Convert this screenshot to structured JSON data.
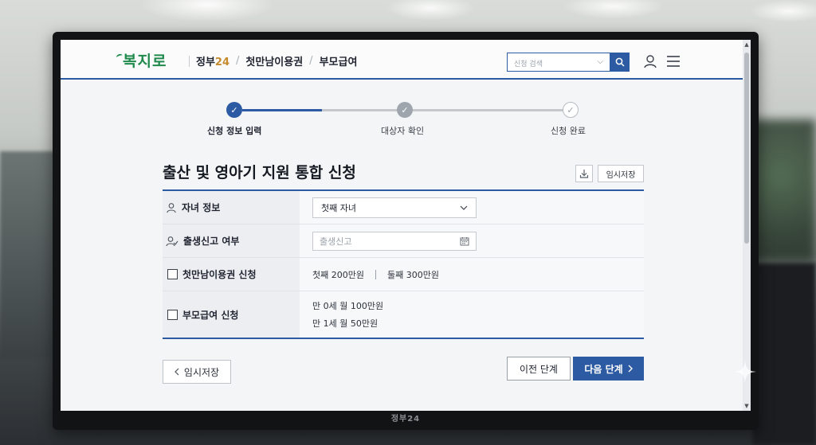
{
  "header": {
    "logo": "복지로",
    "nav": [
      {
        "label_main": "정부",
        "label_accent": "24"
      },
      {
        "label": "첫만남이용권"
      },
      {
        "label": "부모급여"
      }
    ],
    "search_placeholder": "신청 검색",
    "accent_color": "#2d5ba3"
  },
  "stepper": {
    "steps": [
      {
        "label": "신청 정보 입력",
        "state": "active"
      },
      {
        "label": "대상자 확인",
        "state": "done"
      },
      {
        "label": "신청 완료",
        "state": "pending"
      }
    ]
  },
  "page": {
    "title": "출산 및 영아기 지원 통합 신청",
    "temp_save_label": "임시저장"
  },
  "form": {
    "rows": [
      {
        "label": "자녀 정보",
        "icon": "user-icon",
        "value": "첫째 자녀"
      },
      {
        "label": "출생신고 여부",
        "icon": "user-check-icon",
        "placeholder": "출생신고"
      },
      {
        "label": "첫만남이용권 신청",
        "checked": false,
        "amounts": [
          "첫째 200만원",
          "둘째 300만원"
        ]
      },
      {
        "label": "부모급여 신청",
        "checked": false,
        "lines": [
          "만 0세 월 100만원",
          "만 1세 월 50만원"
        ]
      }
    ]
  },
  "footer": {
    "temp_save_label": "임시저장",
    "back_label": "이전 단계",
    "next_label": "다음 단계"
  },
  "monitor": {
    "brand": "정부24"
  }
}
